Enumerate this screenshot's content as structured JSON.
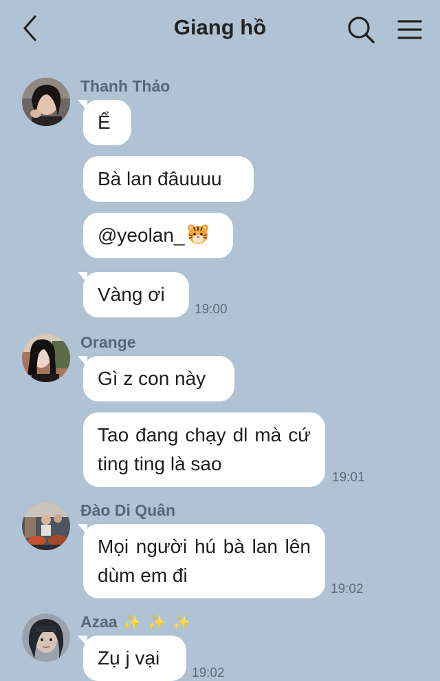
{
  "header": {
    "title": "Giang hồ",
    "back_icon": "chevron-left-icon",
    "search_icon": "search-icon",
    "menu_icon": "hamburger-menu-icon"
  },
  "colors": {
    "background": "#b0c3d4",
    "bubble": "#ffffff",
    "sender_name": "#566877",
    "timestamp": "#5d6c79"
  },
  "messages": [
    {
      "sender": "Thanh Thảo",
      "bubbles": [
        "Ể",
        "Bà lan đâuuuu",
        "@yeolan_",
        "Vàng ơi"
      ],
      "time": "19:00"
    },
    {
      "sender": "Orange",
      "bubbles": [
        "Gì z con này",
        "Tao đang chạy dl mà cứ ting ting là sao"
      ],
      "time": "19:01"
    },
    {
      "sender": "Đào Di Quân",
      "bubbles": [
        "Mọi người hú bà lan lên dùm em đi"
      ],
      "time": "19:02"
    },
    {
      "sender": "Azaa",
      "sender_suffix": "✨ ✨ ✨",
      "bubbles": [
        "Zụ j vại"
      ],
      "time": "19:02"
    }
  ]
}
